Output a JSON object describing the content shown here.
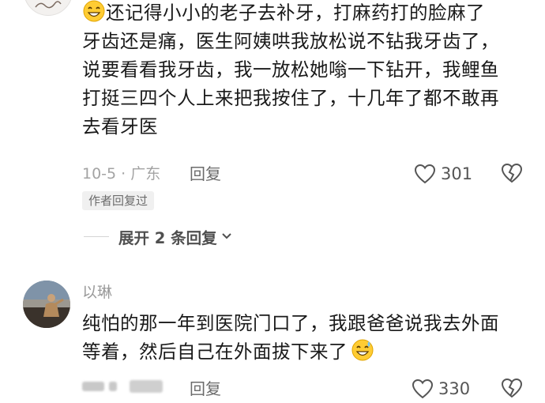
{
  "comment1": {
    "lines": [
      "还记得小小的老子去补牙，打麻药打的脸麻了",
      "牙齿还是痛，医生阿姨哄我放松说不钻我牙齿了，",
      "说要看看我牙齿，我一放松她嗡一下钻开，我鲤鱼",
      "打挺三四个人上来把我按住了，十几年了都不敢再",
      "去看牙医"
    ],
    "leading_emoji": "grinning-sweat-emoji",
    "date_location": "10-5 · 广东",
    "reply_label": "回复",
    "like_count": "301",
    "author_badge": "作者回复过",
    "expand_label": "展开 2 条回复"
  },
  "comment2": {
    "username": "以琳",
    "lines": [
      "纯怕的那一年到医院门口了，我跟爸爸说我去外面",
      "等着，然后自己在外面拔下来了"
    ],
    "trailing_emoji": "grinning-sweat-emoji",
    "reply_label": "回复",
    "like_count": "330"
  },
  "colors": {
    "text": "#1a1a1a",
    "meta": "#a3a3a3",
    "badge_bg": "#f0f0f0",
    "icon": "#555555"
  }
}
